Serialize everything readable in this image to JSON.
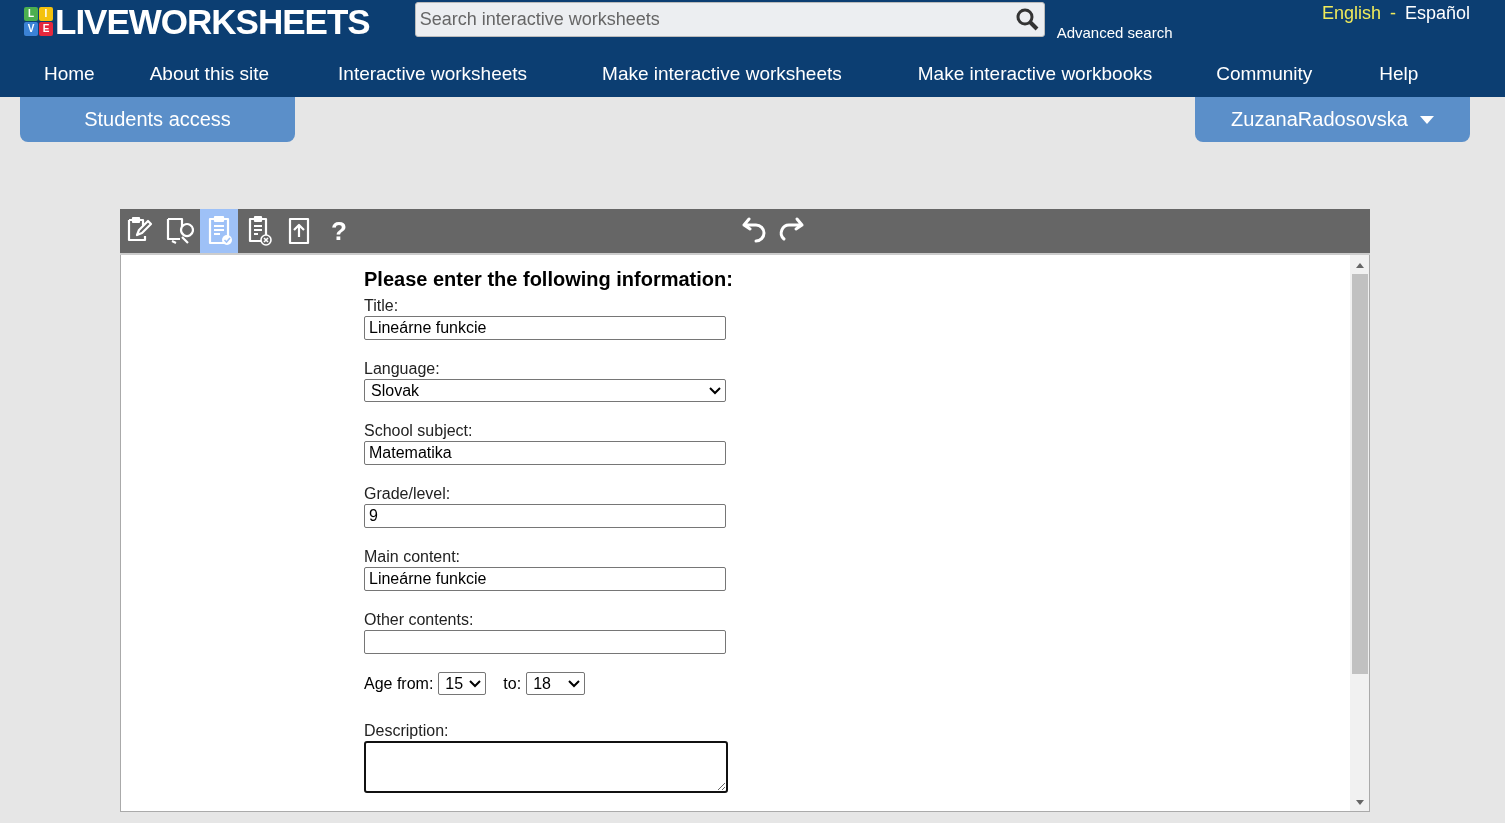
{
  "logo": {
    "tiles": [
      {
        "letter": "L",
        "color": "#4caf50"
      },
      {
        "letter": "I",
        "color": "#f4c20d"
      },
      {
        "letter": "V",
        "color": "#3b82d6"
      },
      {
        "letter": "E",
        "color": "#e5283d"
      }
    ],
    "text": "LIVEWORKSHEETS"
  },
  "search": {
    "placeholder": "Search interactive worksheets",
    "advanced": "Advanced search"
  },
  "languages": [
    {
      "label": "English",
      "selected": true
    },
    {
      "label": "Español",
      "selected": false
    }
  ],
  "language_separator": "-",
  "nav": [
    "Home",
    "About this site",
    "Interactive worksheets",
    "Make interactive worksheets",
    "Make interactive workbooks",
    "Community",
    "Help"
  ],
  "students_access": "Students access",
  "user_menu": "ZuzanaRadosovska",
  "toolbar": {
    "tools": [
      {
        "kind": "edit",
        "selected": false
      },
      {
        "kind": "preview",
        "selected": false
      },
      {
        "kind": "save",
        "selected": true
      },
      {
        "kind": "discard",
        "selected": false
      },
      {
        "kind": "upload",
        "selected": false
      },
      {
        "kind": "help",
        "text": "?",
        "selected": false
      }
    ],
    "history": [
      {
        "kind": "undo"
      },
      {
        "kind": "redo"
      }
    ]
  },
  "form": {
    "heading": "Please enter the following information:",
    "fields": [
      {
        "kind": "text",
        "label": "Title:",
        "value": "Lineárne funkcie"
      },
      {
        "kind": "select",
        "label": "Language:",
        "value": "Slovak"
      },
      {
        "kind": "text",
        "label": "School subject:",
        "value": "Matematika"
      },
      {
        "kind": "text",
        "label": "Grade/level:",
        "value": "9"
      },
      {
        "kind": "text",
        "label": "Main content:",
        "value": "Lineárne funkcie"
      },
      {
        "kind": "text",
        "label": "Other contents:"
      }
    ],
    "age": {
      "from_label": "Age from:",
      "from": "15",
      "to_label": "to:",
      "to": "18"
    },
    "description": {
      "label": "Description:"
    }
  }
}
